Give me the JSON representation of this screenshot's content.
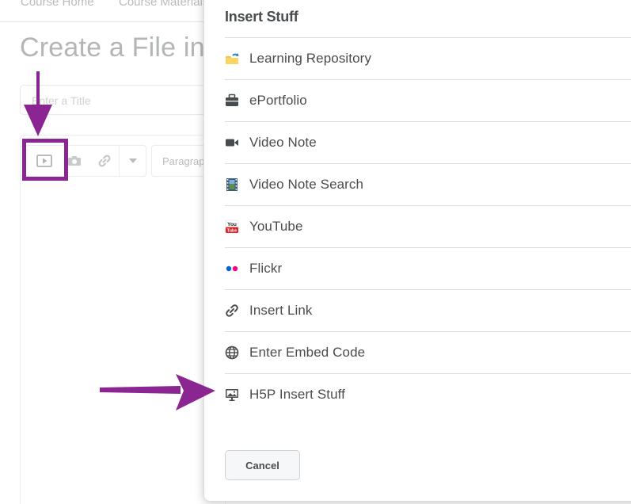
{
  "background": {
    "nav": [
      "Course Home",
      "Course Materials"
    ],
    "page_title": "Create a File in",
    "title_placeholder": "Enter a Title",
    "paragraph_select": "Paragraph"
  },
  "dialog": {
    "title": "Insert Stuff",
    "items": [
      {
        "label": "Learning Repository",
        "icon": "learning-repository-icon"
      },
      {
        "label": "ePortfolio",
        "icon": "briefcase-icon"
      },
      {
        "label": "Video Note",
        "icon": "video-camera-icon"
      },
      {
        "label": "Video Note Search",
        "icon": "film-strip-icon"
      },
      {
        "label": "YouTube",
        "icon": "youtube-icon"
      },
      {
        "label": "Flickr",
        "icon": "flickr-icon"
      },
      {
        "label": "Insert Link",
        "icon": "link-icon"
      },
      {
        "label": "Enter Embed Code",
        "icon": "globe-icon"
      },
      {
        "label": "H5P Insert Stuff",
        "icon": "h5p-presentation-icon"
      }
    ],
    "cancel_label": "Cancel"
  },
  "colors": {
    "annotation_purple": "#8b2592",
    "text": "#494c4e",
    "divider": "#dedede"
  }
}
